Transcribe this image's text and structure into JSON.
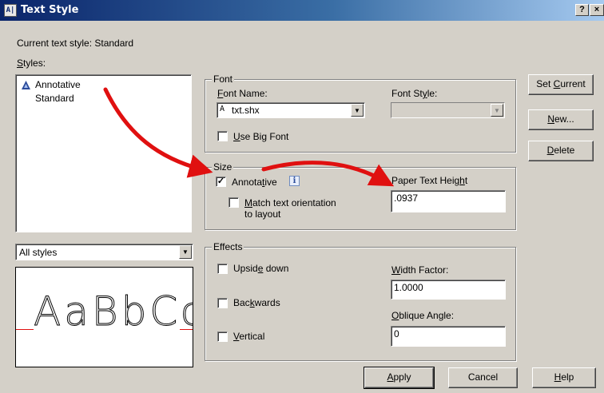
{
  "window": {
    "title": "Text Style",
    "help_btn": "?",
    "close_btn": "×",
    "icon": "ruler-icon"
  },
  "current_style": {
    "label": "Current text style:",
    "value": "Standard"
  },
  "styles": {
    "label": "Styles:",
    "items": [
      "Annotative",
      "Standard"
    ],
    "filter": "All styles"
  },
  "font": {
    "group": "Font",
    "name_label": "Font Name:",
    "name_value": "txt.shx",
    "style_label": "Font Style:",
    "style_value": "",
    "big_font_label": "Use Big Font",
    "big_font_checked": false
  },
  "size": {
    "group": "Size",
    "annotative_label": "Annotative",
    "annotative_checked": true,
    "info_icon": "i",
    "match_label_line1": "Match text orientation",
    "match_label_line2": "to layout",
    "match_checked": false,
    "height_label": "Paper Text Height",
    "height_value": ".0937"
  },
  "effects": {
    "group": "Effects",
    "upside_down": "Upside down",
    "backwards": "Backwards",
    "vertical": "Vertical",
    "width_label": "Width Factor:",
    "width_value": "1.0000",
    "oblique_label": "Oblique Angle:",
    "oblique_value": "0"
  },
  "preview": {
    "text": "AaBbCc"
  },
  "buttons": {
    "set_current": "Set Current",
    "new": "New...",
    "delete": "Delete",
    "apply": "Apply",
    "cancel": "Cancel",
    "help": "Help"
  },
  "colors": {
    "annotation_arrow": "#e01010",
    "title_bar": "#0a246a",
    "dialog_bg": "#d4d0c8"
  }
}
